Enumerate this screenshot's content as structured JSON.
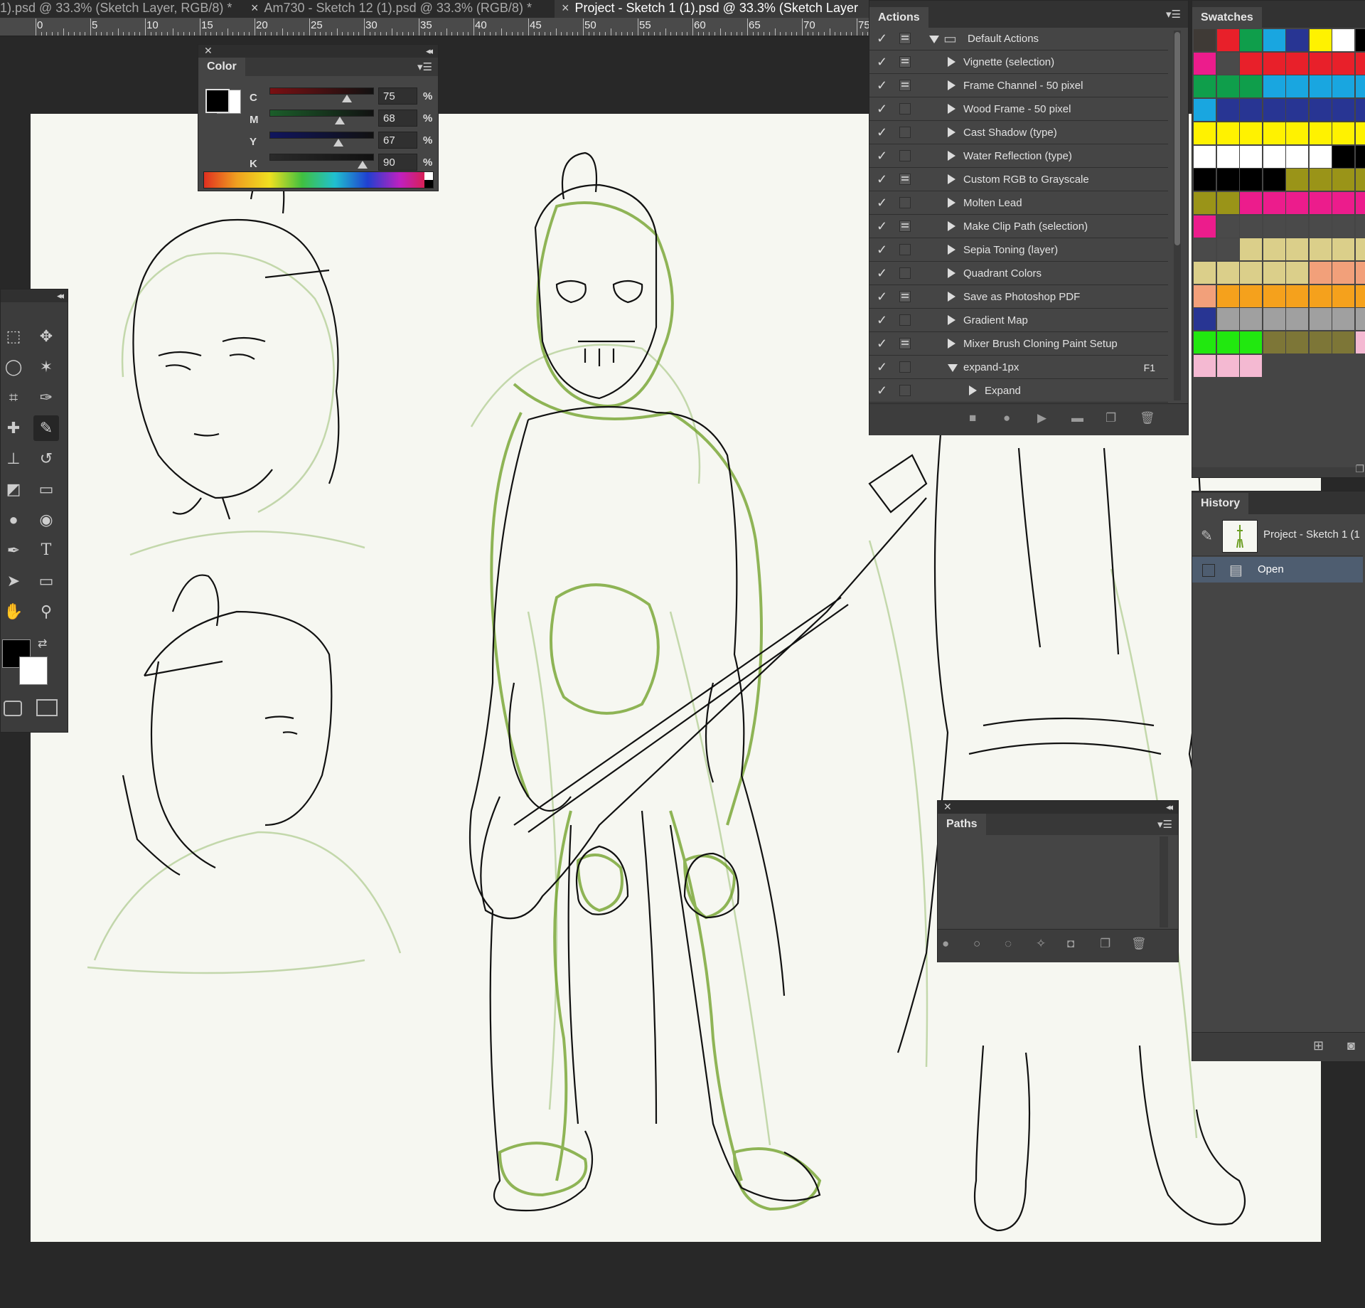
{
  "tabs": [
    {
      "label": "1).psd @ 33.3% (Sketch Layer, RGB/8) *",
      "active": false
    },
    {
      "label": "Am730 - Sketch 12 (1).psd @ 33.3% (RGB/8) *",
      "active": false
    },
    {
      "label": "Project - Sketch 1 (1).psd @ 33.3% (Sketch Layer",
      "active": true
    }
  ],
  "tab_close_glyph": "×",
  "ruler_ticks": [
    "0",
    "5",
    "10",
    "15",
    "20",
    "25",
    "30",
    "35",
    "40",
    "45",
    "50",
    "55",
    "60",
    "65",
    "70",
    "75"
  ],
  "color_panel": {
    "title": "Color",
    "foreground": "#000000",
    "background": "#ffffff",
    "sliders": [
      {
        "label": "C",
        "value": "75",
        "unit": "%",
        "fraction": 0.75,
        "track": "#7a0f12"
      },
      {
        "label": "M",
        "value": "68",
        "unit": "%",
        "fraction": 0.68,
        "track": "#1b5e2a"
      },
      {
        "label": "Y",
        "value": "67",
        "unit": "%",
        "fraction": 0.67,
        "track": "#10155e"
      },
      {
        "label": "K",
        "value": "90",
        "unit": "%",
        "fraction": 0.9,
        "track": "#2a2a2a"
      }
    ]
  },
  "actions_panel": {
    "title": "Actions",
    "rows": [
      {
        "label": "Default Actions",
        "level": 0,
        "expanded": true,
        "folder": true,
        "dialog": true
      },
      {
        "label": "Vignette (selection)",
        "level": 1,
        "expanded": false,
        "dialog": true
      },
      {
        "label": "Frame Channel - 50 pixel",
        "level": 1,
        "expanded": false,
        "dialog": true
      },
      {
        "label": "Wood Frame - 50 pixel",
        "level": 1,
        "expanded": false,
        "dialog": false
      },
      {
        "label": "Cast Shadow (type)",
        "level": 1,
        "expanded": false,
        "dialog": false
      },
      {
        "label": "Water Reflection (type)",
        "level": 1,
        "expanded": false,
        "dialog": false
      },
      {
        "label": "Custom RGB to Grayscale",
        "level": 1,
        "expanded": false,
        "dialog": true
      },
      {
        "label": "Molten Lead",
        "level": 1,
        "expanded": false,
        "dialog": false
      },
      {
        "label": "Make Clip Path (selection)",
        "level": 1,
        "expanded": false,
        "dialog": true
      },
      {
        "label": "Sepia Toning (layer)",
        "level": 1,
        "expanded": false,
        "dialog": false
      },
      {
        "label": "Quadrant Colors",
        "level": 1,
        "expanded": false,
        "dialog": false
      },
      {
        "label": "Save as Photoshop PDF",
        "level": 1,
        "expanded": false,
        "dialog": true
      },
      {
        "label": "Gradient Map",
        "level": 1,
        "expanded": false,
        "dialog": false
      },
      {
        "label": "Mixer Brush Cloning Paint Setup",
        "level": 1,
        "expanded": false,
        "dialog": true
      },
      {
        "label": "expand-1px",
        "level": 1,
        "expanded": true,
        "dialog": false,
        "shortcut": "F1"
      },
      {
        "label": "Expand",
        "level": 2,
        "expanded": false,
        "dialog": false
      }
    ],
    "check_glyph": "✓",
    "buttons": [
      {
        "name": "stop",
        "glyph": "■"
      },
      {
        "name": "record",
        "glyph": "●"
      },
      {
        "name": "play",
        "glyph": "▶"
      },
      {
        "name": "new-set",
        "glyph": "▬"
      },
      {
        "name": "new-action",
        "glyph": "❐"
      },
      {
        "name": "delete",
        "glyph": "🗑"
      }
    ]
  },
  "swatches_panel": {
    "title": "Swatches",
    "rows": [
      [
        "#3f3a36",
        "#e8202a",
        "#0f9e4b",
        "#19a6e0",
        "#283593",
        "#fff200",
        "#ffffff",
        "#000000"
      ],
      [
        "#ec1c8c",
        "#4a4a4a",
        "#e8202a",
        "#e8202a",
        "#e8202a",
        "#e8202a",
        "#e8202a",
        "#e8202a"
      ],
      [
        "#0f9e4b",
        "#0f9e4b",
        "#0f9e4b",
        "#19a6e0",
        "#19a6e0",
        "#19a6e0",
        "#19a6e0",
        "#19a6e0"
      ],
      [
        "#19a6e0",
        "#283593",
        "#283593",
        "#283593",
        "#283593",
        "#283593",
        "#283593",
        "#283593"
      ],
      [
        "#fff200",
        "#fff200",
        "#fff200",
        "#fff200",
        "#fff200",
        "#fff200",
        "#fff200",
        "#fff200"
      ],
      [
        "#ffffff",
        "#ffffff",
        "#ffffff",
        "#ffffff",
        "#ffffff",
        "#ffffff",
        "#000000",
        "#000000"
      ],
      [
        "#000000",
        "#000000",
        "#000000",
        "#000000",
        "#9a9418",
        "#9a9418",
        "#9a9418",
        "#9a9418"
      ],
      [
        "#9a9418",
        "#9a9418",
        "#ec1c8c",
        "#ec1c8c",
        "#ec1c8c",
        "#ec1c8c",
        "#ec1c8c",
        "#ec1c8c"
      ],
      [
        "#ec1c8c",
        "#4a4a4a",
        "#4a4a4a",
        "#4a4a4a",
        "#4a4a4a",
        "#4a4a4a",
        "#4a4a4a",
        "#4a4a4a"
      ],
      [
        "#4a4a4a",
        "#4a4a4a",
        "#dbcf8a",
        "#dbcf8a",
        "#dbcf8a",
        "#dbcf8a",
        "#dbcf8a",
        "#dbcf8a"
      ],
      [
        "#dbcf8a",
        "#dbcf8a",
        "#dbcf8a",
        "#dbcf8a",
        "#dbcf8a",
        "#f2a07a",
        "#f2a07a",
        "#f2a07a"
      ],
      [
        "#f2a07a",
        "#f5a11c",
        "#f5a11c",
        "#f5a11c",
        "#f5a11c",
        "#f5a11c",
        "#f5a11c",
        "#f5a11c"
      ],
      [
        "#283593",
        "#a0a0a0",
        "#a0a0a0",
        "#a0a0a0",
        "#a0a0a0",
        "#a0a0a0",
        "#a0a0a0",
        "#a0a0a0"
      ],
      [
        "#21e80f",
        "#21e80f",
        "#21e80f",
        "#7d7637",
        "#7d7637",
        "#7d7637",
        "#7d7637",
        "#f4b9d2"
      ],
      [
        "#f4b9d2",
        "#f4b9d2",
        "#f4b9d2"
      ]
    ]
  },
  "history_panel": {
    "title": "History",
    "snapshot_label": "Project - Sketch 1 (1",
    "items": [
      {
        "label": "Open",
        "selected": true
      }
    ]
  },
  "paths_panel": {
    "title": "Paths",
    "buttons": [
      "fill-path",
      "stroke-path",
      "load-selection",
      "make-path",
      "add-mask",
      "new-path",
      "delete-path"
    ]
  },
  "toolbar": {
    "text_tool_glyph": "T",
    "tools": [
      {
        "name": "marquee-tool"
      },
      {
        "name": "move-tool"
      },
      {
        "name": "lasso-tool"
      },
      {
        "name": "magic-wand-tool"
      },
      {
        "name": "crop-tool"
      },
      {
        "name": "eyedropper-tool"
      },
      {
        "name": "healing-brush-tool"
      },
      {
        "name": "brush-tool",
        "selected": true
      },
      {
        "name": "clone-stamp-tool"
      },
      {
        "name": "history-brush-tool"
      },
      {
        "name": "eraser-tool"
      },
      {
        "name": "gradient-tool"
      },
      {
        "name": "blur-tool"
      },
      {
        "name": "dodge-tool"
      },
      {
        "name": "pen-tool"
      },
      {
        "name": "type-tool"
      },
      {
        "name": "path-selection-tool"
      },
      {
        "name": "rectangle-tool"
      },
      {
        "name": "hand-tool"
      },
      {
        "name": "zoom-tool"
      }
    ],
    "foreground": "#000000",
    "background": "#ffffff"
  }
}
